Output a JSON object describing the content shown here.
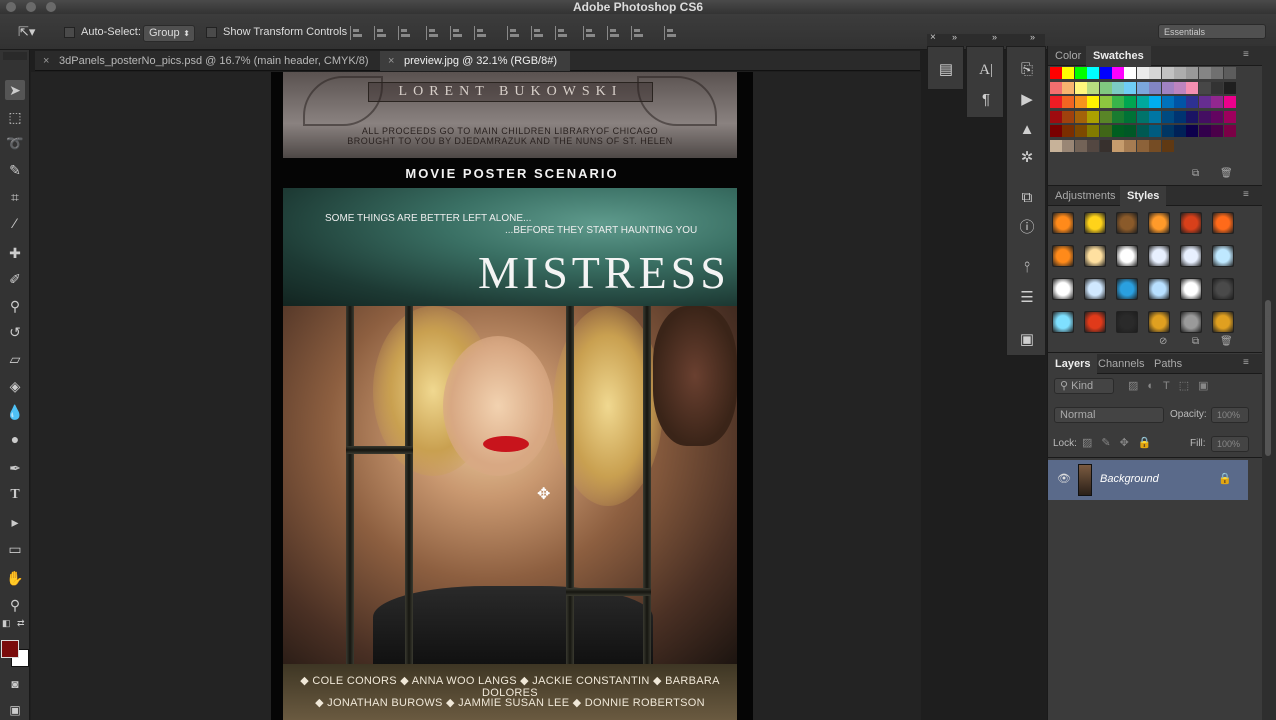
{
  "app": {
    "title": "Adobe Photoshop CS6",
    "workspace": "Essentials"
  },
  "options_bar": {
    "auto_select_label": "Auto-Select:",
    "auto_select_value": "Group",
    "transform_label": "Show Transform Controls"
  },
  "tabs": [
    {
      "label": "3dPanels_posterNo_pics.psd @ 16.7% (main header, CMYK/8)",
      "close": "×",
      "active": false
    },
    {
      "label": "preview.jpg @ 32.1% (RGB/8#)",
      "close": "×",
      "active": true
    }
  ],
  "poster": {
    "brand": "LORENT BUKOWSKI",
    "credit_line1": "ALL PROCEEDS GO TO MAIN CHILDREN LIBRARYOF CHICAGO",
    "credit_line2": "BROUGHT TO YOU BY DJEDAMRAZUK AND THE NUNS OF ST. HELEN",
    "subtitle": "MOVIE POSTER SCENARIO",
    "tagline1": "SOME THINGS ARE BETTER LEFT ALONE...",
    "tagline2": "...BEFORE THEY START HAUNTING YOU",
    "title": "MISTRESS",
    "cast_line1": "◆ COLE CONORS ◆ ANNA WOO LANGS ◆ JACKIE CONSTANTIN ◆ BARBARA DOLORES",
    "cast_line2": "◆ JONATHAN BUROWS ◆ JAMMIE SUSAN LEE ◆ DONNIE ROBERTSON"
  },
  "swatches_panel": {
    "tabs": [
      "Color",
      "Swatches"
    ],
    "active_tab": "Swatches",
    "rows": [
      [
        "#ff0000",
        "#ffff00",
        "#00ff00",
        "#00ffff",
        "#0000ff",
        "#ff00ff",
        "#ffffff",
        "#ebebeb",
        "#d6d6d6",
        "#c2c2c2",
        "#adadad",
        "#999999",
        "#858585",
        "#707070",
        "#5c5c5c"
      ],
      [
        "#f36f6f",
        "#f8b46f",
        "#fff77d",
        "#b8dc80",
        "#80c880",
        "#7ccbc5",
        "#6fcdf5",
        "#7ba7dc",
        "#8185c3",
        "#a082c2",
        "#bd84bf",
        "#f48fb1",
        "#474747",
        "#333333",
        "#1f1f1f"
      ],
      [
        "#ee1c24",
        "#f26522",
        "#f7941d",
        "#fff200",
        "#8dc63f",
        "#39b54a",
        "#00a651",
        "#00a99d",
        "#00aeef",
        "#0072bc",
        "#0054a6",
        "#2e3192",
        "#662d91",
        "#92278f",
        "#ec008c"
      ],
      [
        "#9e0b0f",
        "#a0410d",
        "#a36209",
        "#aba000",
        "#598527",
        "#197b30",
        "#007236",
        "#00746b",
        "#0076a3",
        "#004a80",
        "#003471",
        "#1b1464",
        "#440e62",
        "#630460",
        "#9e005d"
      ],
      [
        "#790000",
        "#7b2e00",
        "#7d4900",
        "#827b00",
        "#406618",
        "#005e20",
        "#005826",
        "#005952",
        "#005b7f",
        "#003663",
        "#002157",
        "#0d004c",
        "#32004b",
        "#4b0049",
        "#7b0046"
      ],
      [
        "#c7b299",
        "#998675",
        "#736357",
        "#534741",
        "#37302d",
        "#c69c6d",
        "#a67c52",
        "#8c6239",
        "#754c24",
        "#603913"
      ]
    ]
  },
  "styles_panel": {
    "tabs": [
      "Adjustments",
      "Styles"
    ],
    "active_tab": "Styles",
    "cells": [
      [
        "#ff8a1a",
        "#ffd31a",
        "#8a5a2a",
        "#ff9a2a",
        "#d8401a",
        "#ff6a1a"
      ],
      [
        "#ff8a1a",
        "#ffe0a0",
        "#ffffff",
        "#e8f0ff",
        "#e8f0ff",
        "#bfe8ff"
      ],
      [
        "#ffffff",
        "#d0e8ff",
        "#2aa0e0",
        "#b8e0ff",
        "#ffffff",
        "#4a4a4a"
      ],
      [
        "#7fe0ff",
        "#e03a1a",
        "#2a2a2a",
        "#e0a020",
        "#9a9a9a",
        "#e0a020"
      ]
    ]
  },
  "layers_panel": {
    "tabs": [
      "Layers",
      "Channels",
      "Paths"
    ],
    "active_tab": "Layers",
    "kind_label": "Kind",
    "blend_mode": "Normal",
    "opacity_label": "Opacity:",
    "opacity_value": "100%",
    "lock_label": "Lock:",
    "fill_label": "Fill:",
    "fill_value": "100%",
    "layer_name": "Background"
  },
  "colors": {
    "foreground": "#7a0c0c",
    "background": "#ffffff",
    "selected_layer": "#5a6a8a"
  }
}
